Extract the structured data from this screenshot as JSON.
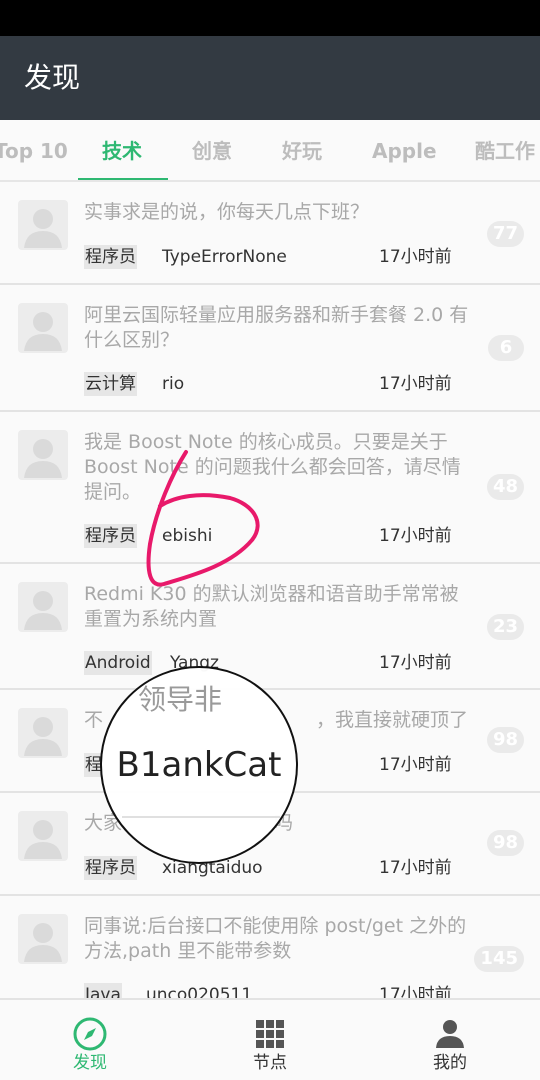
{
  "app": {
    "title": "发现"
  },
  "tabs": [
    {
      "label": "Top 10"
    },
    {
      "label": "技术"
    },
    {
      "label": "创意"
    },
    {
      "label": "好玩"
    },
    {
      "label": "Apple"
    },
    {
      "label": "酷工作"
    }
  ],
  "posts": [
    {
      "title": "实事求是的说，你每天几点下班？",
      "tag": "程序员",
      "author": "TypeErrorNone",
      "time": "17小时前",
      "count": "77"
    },
    {
      "title": "阿里云国际轻量应用服务器和新手套餐 2.0 有什么区别？",
      "tag": "云计算",
      "author": "rio",
      "time": "17小时前",
      "count": "6"
    },
    {
      "title": "我是 Boost Note 的核心成员。只要是关于 Boost Note 的问题我什么都会回答，请尽情提问。",
      "tag": "程序员",
      "author": "ebishi",
      "time": "17小时前",
      "count": "48"
    },
    {
      "title": "Redmi K30 的默认浏览器和语音助手常常被重置为系统内置",
      "tag": "Android",
      "author": "Yangz",
      "time": "17小时前",
      "count": "23"
    },
    {
      "title": "不",
      "title_tail": "，我直接就硬顶了",
      "tag": "程",
      "author": "",
      "time": "17小时前",
      "count": "98"
    },
    {
      "title": "大家",
      "title_tail": "吗",
      "tag": "程序员",
      "author": "xiangtaiduo",
      "time": "17小时前",
      "count": "98"
    },
    {
      "title": "同事说:后台接口不能使用除 post/get 之外的方法,path 里不能带参数",
      "tag": "Java",
      "author": "unco020511",
      "time": "17小时前",
      "count": "145"
    }
  ],
  "magnifier": {
    "text": "B1ankCat",
    "ghost": "领导非"
  },
  "bottom_nav": [
    {
      "label": "发现",
      "icon": "compass-icon"
    },
    {
      "label": "节点",
      "icon": "grid-icon"
    },
    {
      "label": "我的",
      "icon": "person-icon"
    }
  ],
  "colors": {
    "accent": "#2eb872",
    "app_bar": "#333a42",
    "scribble": "#e8196a"
  }
}
